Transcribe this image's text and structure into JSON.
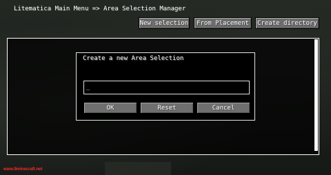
{
  "header": {
    "title": "Litematica Main Menu => Area Selection Manager"
  },
  "toolbar": {
    "new_selection": "New selection",
    "from_placement": "From Placement",
    "create_directory": "Create directory"
  },
  "dialog": {
    "title": "Create a new Area Selection",
    "input_value": "_",
    "ok_label": "OK",
    "reset_label": "Reset",
    "cancel_label": "Cancel"
  },
  "watermark": {
    "text": "www.9minecraft.net"
  }
}
